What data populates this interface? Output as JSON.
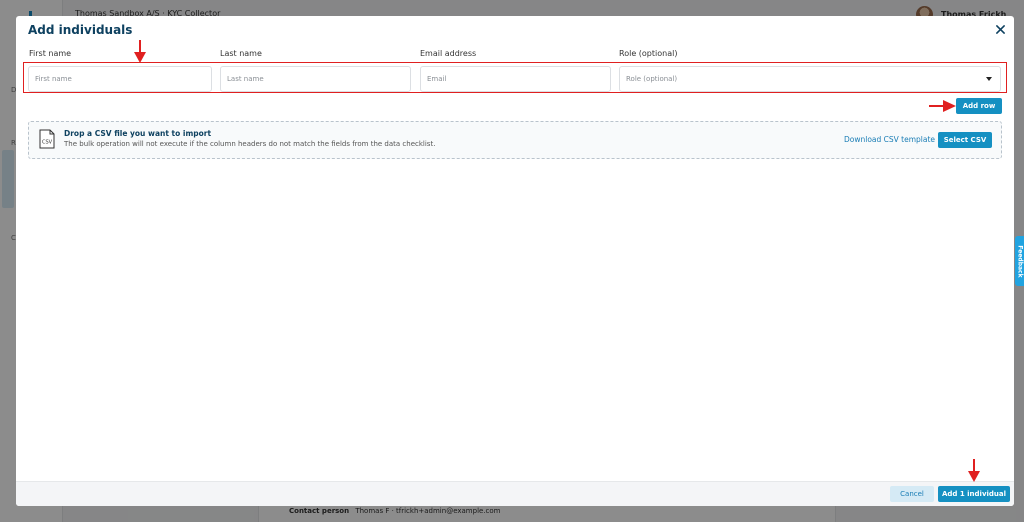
{
  "background": {
    "header_title": "Thomas Sandbox A/S · KYC Collector",
    "user_name": "Thomas Frickh",
    "sidebar_glyphs": [
      "D",
      "R",
      "C"
    ],
    "contact": {
      "label": "Contact person",
      "value": "Thomas F · tfrickh+admin@example.com"
    },
    "feedback_label": "Feedback"
  },
  "modal": {
    "title": "Add individuals",
    "close_icon": "close-icon",
    "columns": {
      "first_name": "First name",
      "last_name": "Last name",
      "email": "Email address",
      "role": "Role (optional)"
    },
    "row": {
      "first_name": {
        "value": "",
        "placeholder": "First name"
      },
      "last_name": {
        "value": "",
        "placeholder": "Last name"
      },
      "email": {
        "value": "",
        "placeholder": "Email"
      },
      "role": {
        "selected": "",
        "placeholder": "Role (optional)"
      }
    },
    "add_row_label": "Add row",
    "csv": {
      "icon": "csv-file-icon",
      "icon_text": "CSV",
      "title": "Drop a CSV file you want to import",
      "subtitle": "The bulk operation will not execute if the column headers do not match the fields from the data checklist.",
      "download_template_label": "Download CSV template",
      "select_label": "Select CSV"
    },
    "footer": {
      "cancel_label": "Cancel",
      "submit_label": "Add 1 individual"
    }
  },
  "colors": {
    "primary": "#1590c2",
    "title": "#0e4160",
    "annotation": "#e02020"
  }
}
